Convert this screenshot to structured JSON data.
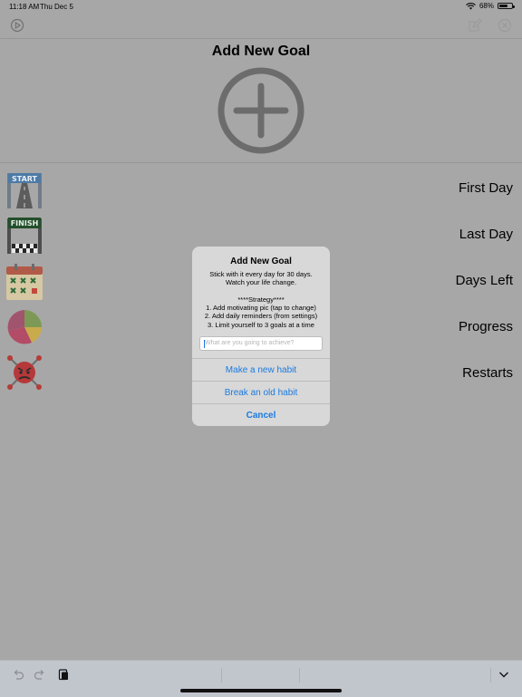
{
  "status_bar": {
    "time": "11:18 AM",
    "date": "Thu Dec 5",
    "battery_percent": "68%",
    "battery_level": 0.68
  },
  "page": {
    "title": "Add New Goal"
  },
  "rows": [
    {
      "label": "First Day",
      "icon": "start-banner-icon"
    },
    {
      "label": "Last Day",
      "icon": "finish-banner-icon"
    },
    {
      "label": "Days Left",
      "icon": "calendar-icon"
    },
    {
      "label": "Progress",
      "icon": "pie-chart-icon"
    },
    {
      "label": "Restarts",
      "icon": "angry-bomb-icon"
    }
  ],
  "alert": {
    "title": "Add New Goal",
    "message_lines": [
      "Stick with it every day for 30 days.",
      "Watch your life change.",
      "",
      "****Strategy****",
      "1. Add motivating pic (tap to change)",
      "2. Add daily reminders (from settings)",
      "3. Limit yourself to 3 goals at a time"
    ],
    "input_placeholder": "What are you going to achieve?",
    "input_value": "",
    "buttons": {
      "new_habit": "Make a new habit",
      "break_habit": "Break an old habit",
      "cancel": "Cancel"
    }
  },
  "icons": {
    "start_banner_text": "START",
    "finish_banner_text": "FINISH"
  },
  "colors": {
    "accent": "#1a7ae0",
    "dim_background": "#a7a7a7",
    "alert_background": "#d8d8d8"
  }
}
